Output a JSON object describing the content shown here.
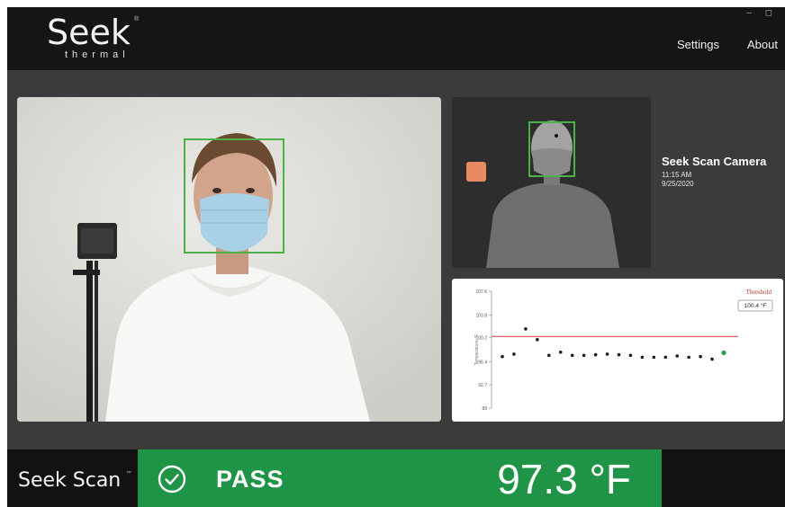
{
  "header": {
    "logo_text": "Seek",
    "logo_registered": "®",
    "logo_subtitle": "thermal",
    "window_controls": "– ◻",
    "nav": {
      "settings": "Settings",
      "about": "About"
    }
  },
  "camera_info": {
    "name": "Seek Scan Camera",
    "time": "11:15 AM",
    "date": "9/25/2020"
  },
  "chart_data": {
    "type": "scatter",
    "title": "",
    "ylabel": "Temperature °F",
    "xlabel": "",
    "yticks": [
      "107.6",
      "103.8",
      "100.2",
      "96.4",
      "92.7",
      "89"
    ],
    "ylim": [
      89,
      107.6
    ],
    "threshold_label": "Threshold",
    "threshold_value_label": "100.4 °F",
    "threshold": 100.4,
    "grid": false,
    "series": [
      {
        "values": [
          97.2,
          97.6,
          101.6,
          99.9,
          97.4,
          97.9,
          97.4,
          97.4,
          97.5,
          97.6,
          97.5,
          97.4,
          97.1,
          97.1,
          97.1,
          97.3,
          97.1,
          97.2,
          96.8,
          97.8
        ],
        "highlight_last": true
      }
    ],
    "colors": {
      "point": "#1e1e1e",
      "threshold_line": "#d9534f",
      "latest_point": "#21a34f"
    }
  },
  "bottom_bar": {
    "brand": "Seek Scan",
    "brand_tm": "™",
    "status": "PASS",
    "temperature": "97.3 °F",
    "status_color": "#1f9446"
  }
}
